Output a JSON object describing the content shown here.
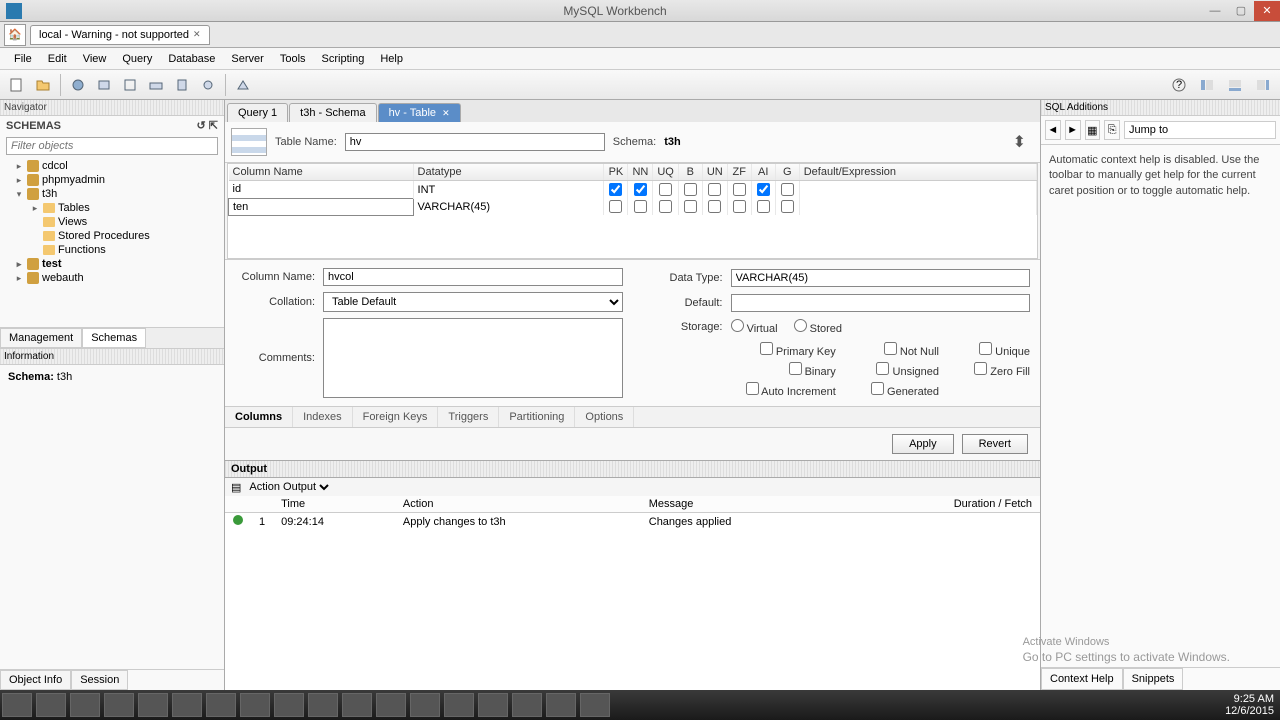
{
  "titlebar": {
    "title": "MySQL Workbench"
  },
  "doc_tab": {
    "label": "local - Warning - not supported"
  },
  "menu": [
    "File",
    "Edit",
    "View",
    "Query",
    "Database",
    "Server",
    "Tools",
    "Scripting",
    "Help"
  ],
  "nav": {
    "header": "Navigator",
    "schemas": "SCHEMAS",
    "filter": "Filter objects"
  },
  "tree": {
    "cdcol": "cdcol",
    "phpmyadmin": "phpmyadmin",
    "t3h": "t3h",
    "tables": "Tables",
    "views": "Views",
    "sp": "Stored Procedures",
    "func": "Functions",
    "test": "test",
    "webauth": "webauth"
  },
  "mgmt": {
    "management": "Management",
    "schemas": "Schemas"
  },
  "info": {
    "header": "Information",
    "schema_lbl": "Schema:",
    "schema_val": "t3h"
  },
  "objtabs": {
    "objinfo": "Object Info",
    "session": "Session"
  },
  "editor_tabs": {
    "q1": "Query 1",
    "t3h": "t3h - Schema",
    "hv": "hv - Table"
  },
  "table_editor": {
    "name_lbl": "Table Name:",
    "name_val": "hv",
    "schema_lbl": "Schema:",
    "schema_val": "t3h",
    "headers": {
      "col": "Column Name",
      "dt": "Datatype",
      "pk": "PK",
      "nn": "NN",
      "uq": "UQ",
      "b": "B",
      "un": "UN",
      "zf": "ZF",
      "ai": "AI",
      "g": "G",
      "def": "Default/Expression"
    },
    "rows": [
      {
        "name": "id",
        "dt": "INT",
        "pk": true,
        "nn": true,
        "uq": false,
        "b": false,
        "un": false,
        "zf": false,
        "ai": true,
        "g": false
      },
      {
        "name": "ten",
        "dt": "VARCHAR(45)",
        "pk": false,
        "nn": false,
        "uq": false,
        "b": false,
        "un": false,
        "zf": false,
        "ai": false,
        "g": false,
        "editing": true
      }
    ]
  },
  "col_detail": {
    "name_lbl": "Column Name:",
    "name_val": "hvcol",
    "collation_lbl": "Collation:",
    "collation_val": "Table Default",
    "comments_lbl": "Comments:",
    "datatype_lbl": "Data Type:",
    "datatype_val": "VARCHAR(45)",
    "default_lbl": "Default:",
    "storage_lbl": "Storage:",
    "virtual": "Virtual",
    "stored": "Stored",
    "pk": "Primary Key",
    "nn": "Not Null",
    "uq": "Unique",
    "bin": "Binary",
    "un": "Unsigned",
    "zf": "Zero Fill",
    "ai": "Auto Increment",
    "gen": "Generated"
  },
  "detail_tabs": [
    "Columns",
    "Indexes",
    "Foreign Keys",
    "Triggers",
    "Partitioning",
    "Options"
  ],
  "apply": {
    "apply": "Apply",
    "revert": "Revert"
  },
  "output": {
    "header": "Output",
    "selector": "Action Output",
    "cols": {
      "time": "Time",
      "action": "Action",
      "msg": "Message",
      "dur": "Duration / Fetch"
    },
    "rows": [
      {
        "idx": "1",
        "time": "09:24:14",
        "action": "Apply changes to t3h",
        "msg": "Changes applied"
      }
    ]
  },
  "sql_add": {
    "header": "SQL Additions",
    "jump": "Jump to",
    "help": "Automatic context help is disabled. Use the toolbar to manually get help for the current caret position or to toggle automatic help.",
    "tabs": {
      "help": "Context Help",
      "snippets": "Snippets"
    }
  },
  "watermark": {
    "title": "Activate Windows",
    "sub": "Go to PC settings to activate Windows."
  },
  "clock": {
    "time": "9:25 AM",
    "date": "12/6/2015"
  }
}
